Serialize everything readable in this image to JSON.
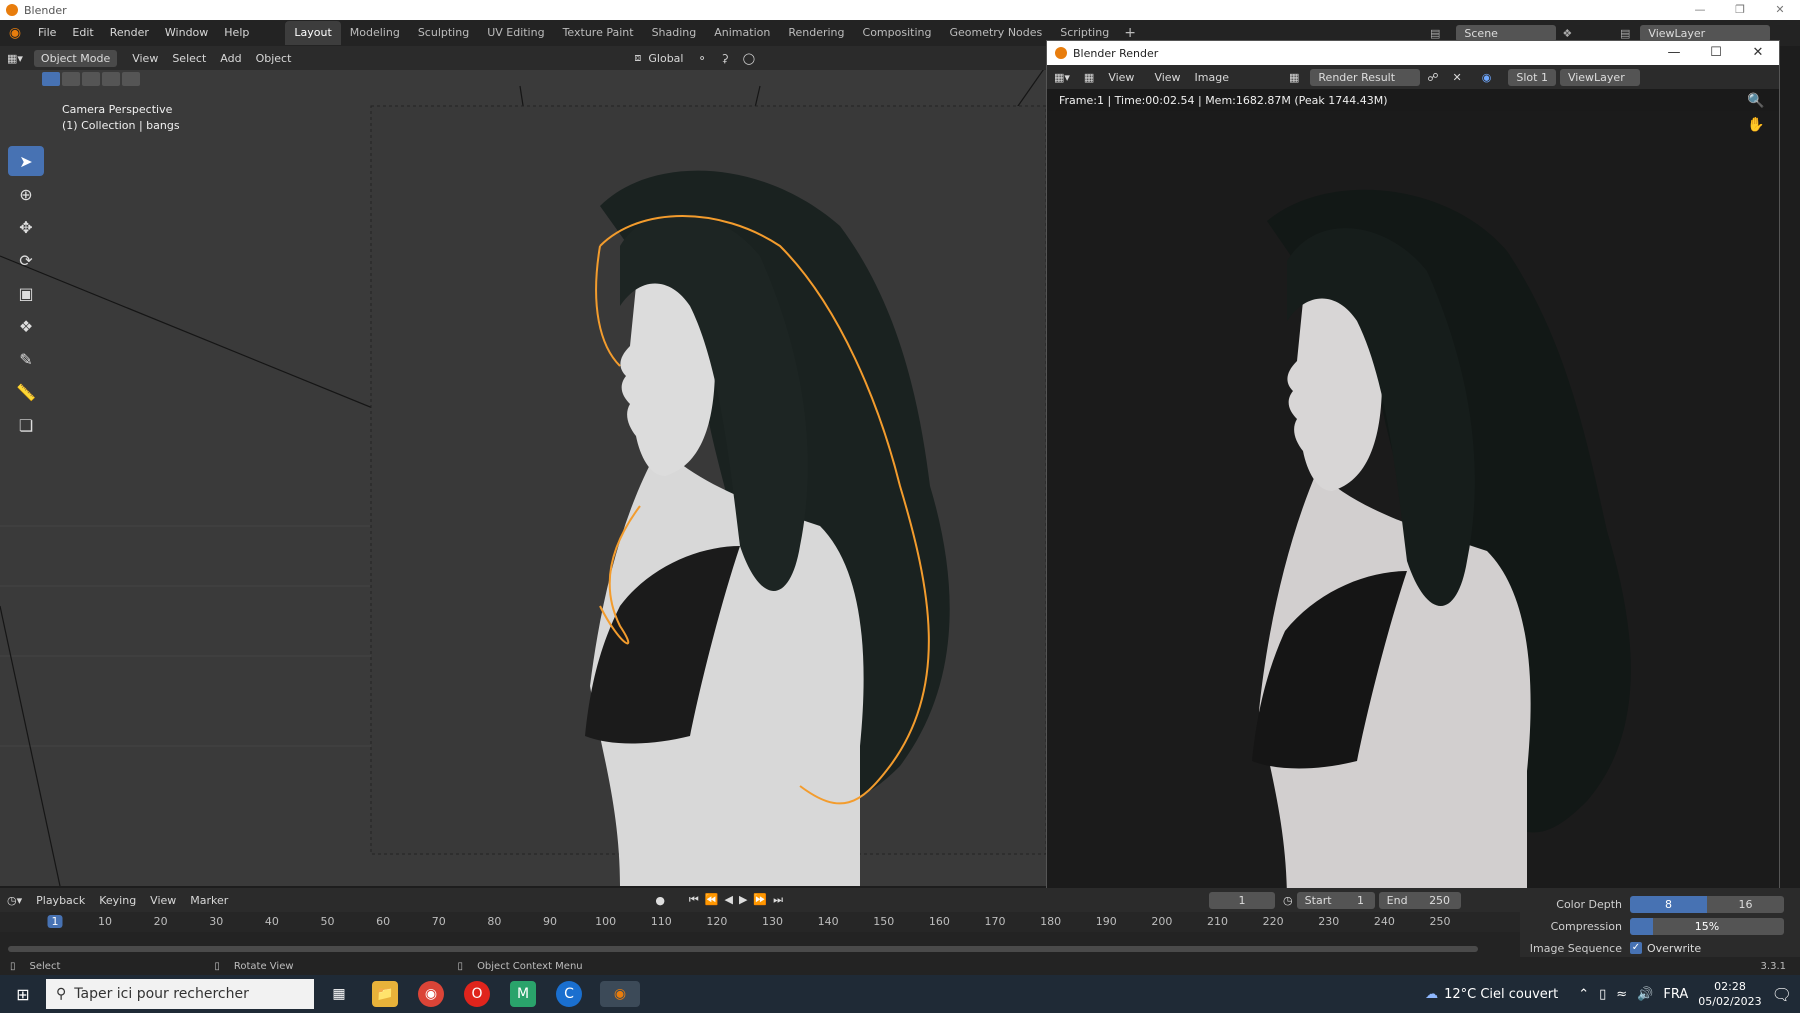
{
  "app": {
    "title": "Blender",
    "version": "3.3.1"
  },
  "menu": [
    "File",
    "Edit",
    "Render",
    "Window",
    "Help"
  ],
  "workspaces": [
    {
      "label": "Layout",
      "active": true
    },
    {
      "label": "Modeling"
    },
    {
      "label": "Sculpting"
    },
    {
      "label": "UV Editing"
    },
    {
      "label": "Texture Paint"
    },
    {
      "label": "Shading"
    },
    {
      "label": "Animation"
    },
    {
      "label": "Rendering"
    },
    {
      "label": "Compositing"
    },
    {
      "label": "Geometry Nodes"
    },
    {
      "label": "Scripting"
    }
  ],
  "scene": {
    "scene_label": "Scene",
    "viewlayer_label": "ViewLayer"
  },
  "viewport": {
    "mode": "Object Mode",
    "menus": [
      "View",
      "Select",
      "Add",
      "Object"
    ],
    "transform": "Global",
    "camera_label": "Camera Perspective",
    "collection_label": "(1) Collection | bangs"
  },
  "render_window": {
    "title": "Blender Render",
    "menus": [
      "View",
      "View",
      "Image"
    ],
    "image_name": "Render Result",
    "slot": "Slot 1",
    "viewlayer": "ViewLayer",
    "stats": "Frame:1 | Time:00:02.54 | Mem:1682.87M (Peak 1744.43M)"
  },
  "properties": {
    "color_depth_label": "Color Depth",
    "color_depth_options": [
      "8",
      "16"
    ],
    "color_depth_selected": "8",
    "compression_label": "Compression",
    "compression_value": "15%",
    "compression_fraction": 0.15,
    "image_sequence_label": "Image Sequence",
    "overwrite_label": "Overwrite",
    "overwrite_checked": true
  },
  "timeline": {
    "menus": [
      "Playback",
      "Keying",
      "View",
      "Marker"
    ],
    "current_frame": "1",
    "start_label": "Start",
    "start": "1",
    "end_label": "End",
    "end": "250",
    "ticks": [
      "1",
      "10",
      "20",
      "30",
      "40",
      "50",
      "60",
      "70",
      "80",
      "90",
      "100",
      "110",
      "120",
      "130",
      "140",
      "150",
      "160",
      "170",
      "180",
      "190",
      "200",
      "210",
      "220",
      "230",
      "240",
      "250"
    ]
  },
  "status": {
    "select": "Select",
    "rotate": "Rotate View",
    "context": "Object Context Menu"
  },
  "taskbar": {
    "search_placeholder": "Taper ici pour rechercher",
    "weather": "12°C  Ciel couvert",
    "lang": "FRA",
    "time": "02:28",
    "date": "05/02/2023"
  }
}
